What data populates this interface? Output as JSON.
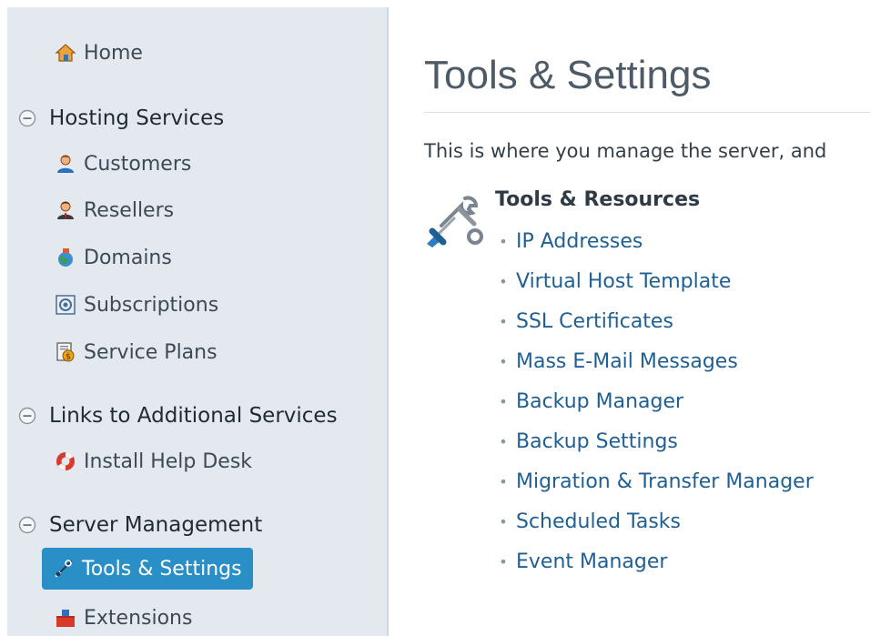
{
  "sidebar": {
    "home": "Home",
    "sections": [
      {
        "title": "Hosting Services",
        "items": [
          "Customers",
          "Resellers",
          "Domains",
          "Subscriptions",
          "Service Plans"
        ]
      },
      {
        "title": "Links to Additional Services",
        "items": [
          "Install Help Desk"
        ]
      },
      {
        "title": "Server Management",
        "items": [
          "Tools & Settings",
          "Extensions"
        ]
      }
    ],
    "active_item": "Tools & Settings"
  },
  "main": {
    "title": "Tools & Settings",
    "intro": "This is where you manage the server, and",
    "section_title": "Tools & Resources",
    "links": [
      "IP Addresses",
      "Virtual Host Template",
      "SSL Certificates",
      "Mass E-Mail Messages",
      "Backup Manager",
      "Backup Settings",
      "Migration & Transfer Manager",
      "Scheduled Tasks",
      "Event Manager"
    ]
  },
  "colors": {
    "sidebar_bg": "#e3e9ee",
    "active_bg": "#2b8fc7",
    "link": "#1f5f94",
    "title": "#4e5b66"
  }
}
